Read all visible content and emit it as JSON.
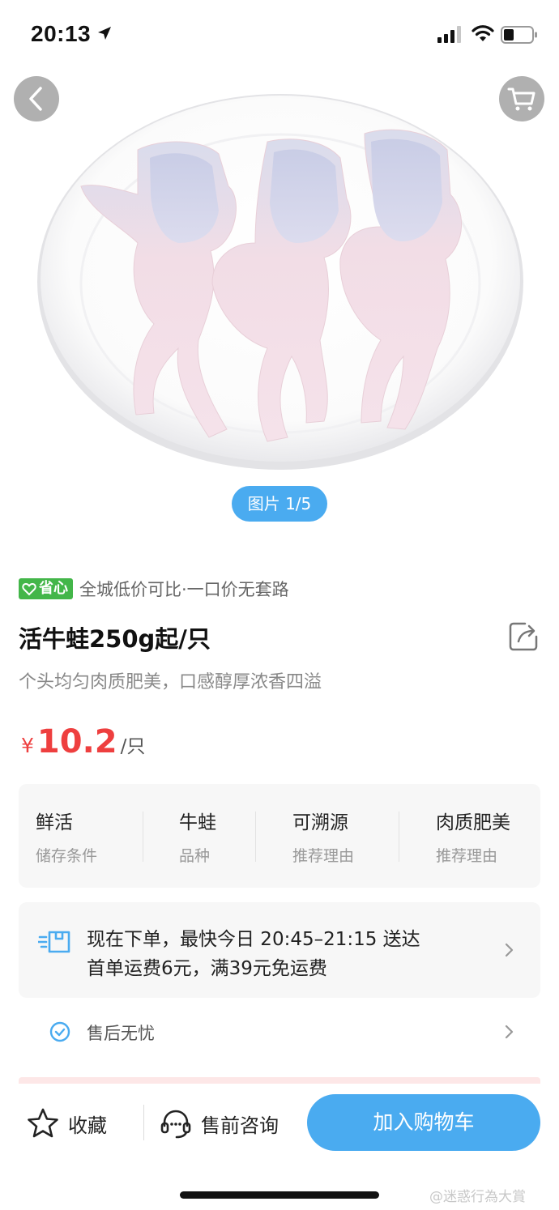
{
  "status_bar": {
    "time": "20:13"
  },
  "gallery": {
    "counter": "图片 1/5"
  },
  "product": {
    "promo_badge": "省心",
    "promo_text": "全城低价可比·一口价无套路",
    "title": "活牛蛙250g起/只",
    "subtitle": "个头均匀肉质肥美，口感醇厚浓香四溢",
    "price": {
      "currency": "¥",
      "value": "10.2",
      "unit": "/只"
    }
  },
  "attributes": [
    {
      "value": "鲜活",
      "label": "储存条件"
    },
    {
      "value": "牛蛙",
      "label": "品种"
    },
    {
      "value": "可溯源",
      "label": "推荐理由"
    },
    {
      "value": "肉质肥美",
      "label": "推荐理由"
    }
  ],
  "delivery": {
    "line1": "现在下单，最快今日 20:45–21:15 送达",
    "line2": "首单运费6元，满39元免运费"
  },
  "after_sale": {
    "label": "售后无忧"
  },
  "bottom_bar": {
    "favorite": "收藏",
    "consult": "售前咨询",
    "add_to_cart": "加入购物车"
  },
  "watermark": "@迷惑行為大賞",
  "colors": {
    "accent_blue": "#4aabf0",
    "price_red": "#ee3f3f",
    "badge_green": "#43b649"
  },
  "icons": [
    "location-arrow-icon",
    "signal-icon",
    "wifi-icon",
    "battery-icon",
    "back-icon",
    "cart-icon",
    "heart-icon",
    "share-icon",
    "delivery-box-icon",
    "chevron-right-icon",
    "check-circle-icon",
    "star-icon",
    "headset-icon"
  ]
}
